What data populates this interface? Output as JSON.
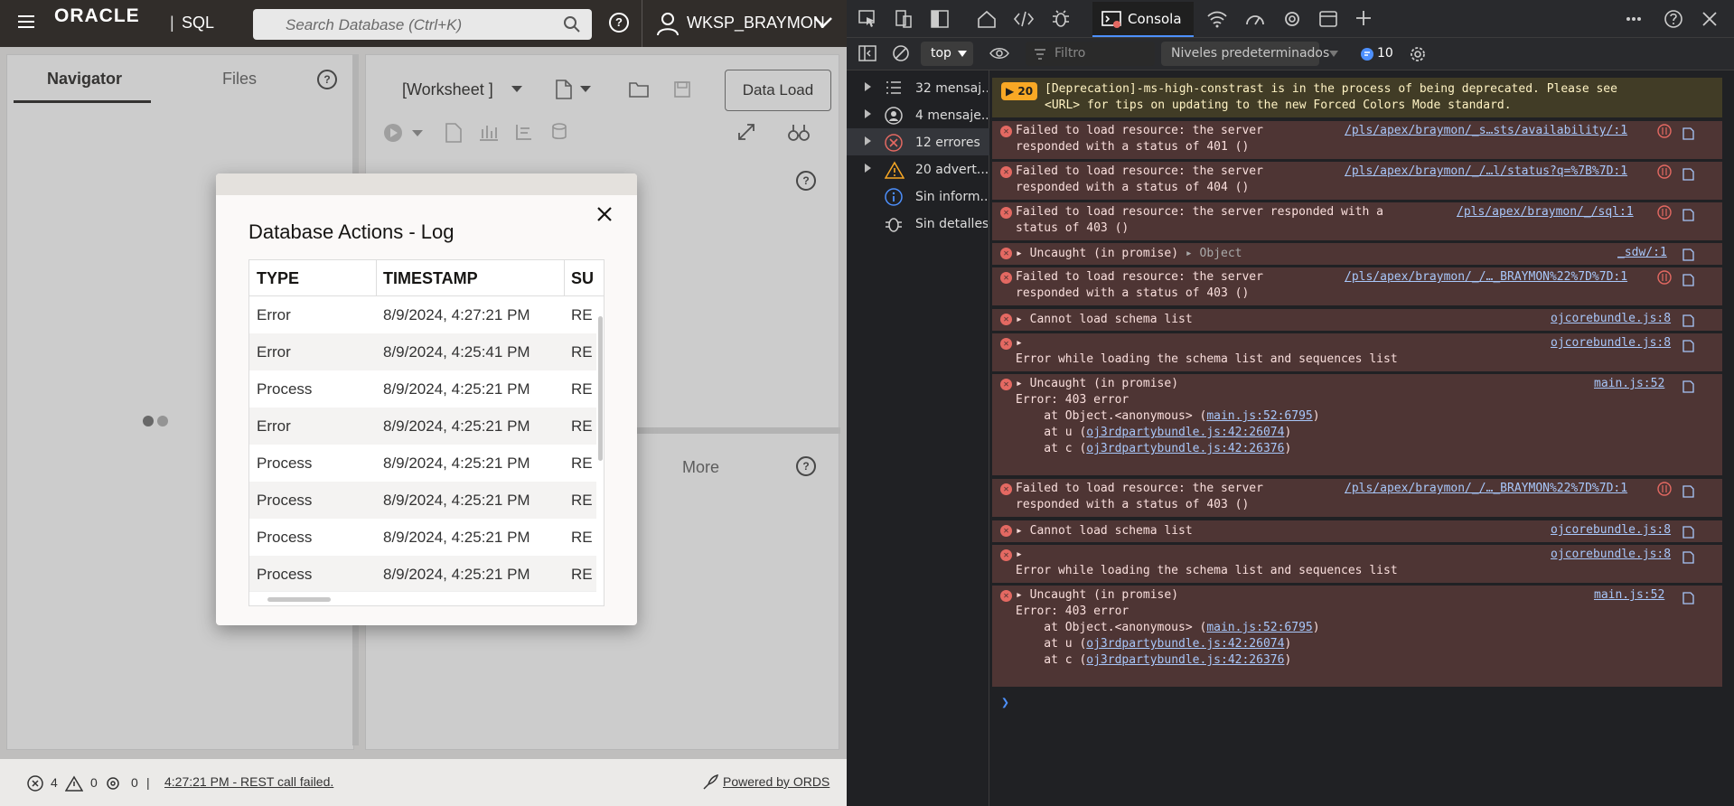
{
  "app": {
    "logo": "ORACLE",
    "logo_separator": "|",
    "product": "SQL",
    "search_placeholder": "Search Database (Ctrl+K)",
    "user": "WKSP_BRAYMON",
    "help": "?"
  },
  "left_panel": {
    "tabs": [
      "Navigator",
      "Files"
    ]
  },
  "right_panel": {
    "worksheet_label": "[Worksheet ]",
    "data_load": "Data Load",
    "more_tab": "More"
  },
  "modal": {
    "title": "Database Actions - Log",
    "columns": [
      "TYPE",
      "TIMESTAMP",
      "SU"
    ],
    "rows": [
      [
        "Error",
        "8/9/2024, 4:27:21 PM",
        "RE"
      ],
      [
        "Error",
        "8/9/2024, 4:25:41 PM",
        "RE"
      ],
      [
        "Process",
        "8/9/2024, 4:25:21 PM",
        "RE"
      ],
      [
        "Error",
        "8/9/2024, 4:25:21 PM",
        "RE"
      ],
      [
        "Process",
        "8/9/2024, 4:25:21 PM",
        "RE"
      ],
      [
        "Process",
        "8/9/2024, 4:25:21 PM",
        "RE"
      ],
      [
        "Process",
        "8/9/2024, 4:25:21 PM",
        "RE"
      ],
      [
        "Process",
        "8/9/2024, 4:25:21 PM",
        "RE"
      ]
    ]
  },
  "statusbar": {
    "errors": "4",
    "warnings": "0",
    "processes": "0",
    "separator": "|",
    "message": "4:27:21 PM - REST call failed.",
    "powered": "Powered by ORDS"
  },
  "devtools": {
    "active_tab": "Consola",
    "context": "top",
    "filter_placeholder": "Filtro",
    "levels": "Niveles predeterminados",
    "issues": "10",
    "sidebar": [
      {
        "label": "32 mensaj...",
        "icon": "list-icon"
      },
      {
        "label": "4 mensaje...",
        "icon": "user-icon"
      },
      {
        "label": "12 errores",
        "icon": "error-icon"
      },
      {
        "label": "20 advert...",
        "icon": "warning-icon"
      },
      {
        "label": "Sin inform...",
        "icon": "info-icon"
      },
      {
        "label": "Sin detalles",
        "icon": "bug-icon"
      }
    ],
    "messages": {
      "warn_count": "20",
      "warn_text": "[Deprecation]-ms-high-constrast is in the process of being deprecated. Please see\n<URL> for tips on updating to the new Forced Colors Mode standard.",
      "m1": "Failed to load resource: the server\nresponded with a status of 401 ()",
      "m1_src": "/pls/apex/braymon/_s…sts/availability/:1",
      "m2": "Failed to load resource: the server\nresponded with a status of 404 ()",
      "m2_src": "/pls/apex/braymon/_/…l/status?q=%7B%7D:1",
      "m3": "Failed to load resource: the server responded with a\nstatus of 403 ()",
      "m3_src": "/pls/apex/braymon/_/sql:1",
      "m4": "Uncaught (in promise)",
      "m4_obj": "Object",
      "m4_src": "_sdw/:1",
      "m5": "Failed to load resource: the server\nresponded with a status of 403 ()",
      "m5_src": "/pls/apex/braymon/_/…_BRAYMON%22%7D%7D:1",
      "m6": "Cannot load schema list",
      "m6_src": "ojcorebundle.js:8",
      "m7": "Error while loading the schema list and sequences list",
      "m7_src": "ojcorebundle.js:8",
      "m8": "Uncaught (in promise)",
      "m8_line2": "Error: 403 error",
      "m8_at1_pre": "    at Object.<anonymous> (",
      "m8_at1_link": "main.js:52:6795",
      "m8_at2_pre": "    at u (",
      "m8_at2_link": "oj3rdpartybundle.js:42:26074",
      "m8_at3_pre": "    at c (",
      "m8_at3_link": "oj3rdpartybundle.js:42:26376",
      "m8_src": "main.js:52",
      "m9": "Failed to load resource: the server\nresponded with a status of 403 ()",
      "m9_src": "/pls/apex/braymon/_/…_BRAYMON%22%7D%7D:1",
      "m10": "Cannot load schema list",
      "m10_src": "ojcorebundle.js:8",
      "m11": "Error while loading the schema list and sequences list",
      "m11_src": "ojcorebundle.js:8",
      "m12": "Uncaught (in promise)",
      "m12_line2": "Error: 403 error",
      "m12_src": "main.js:52",
      "close_paren": ")"
    }
  }
}
